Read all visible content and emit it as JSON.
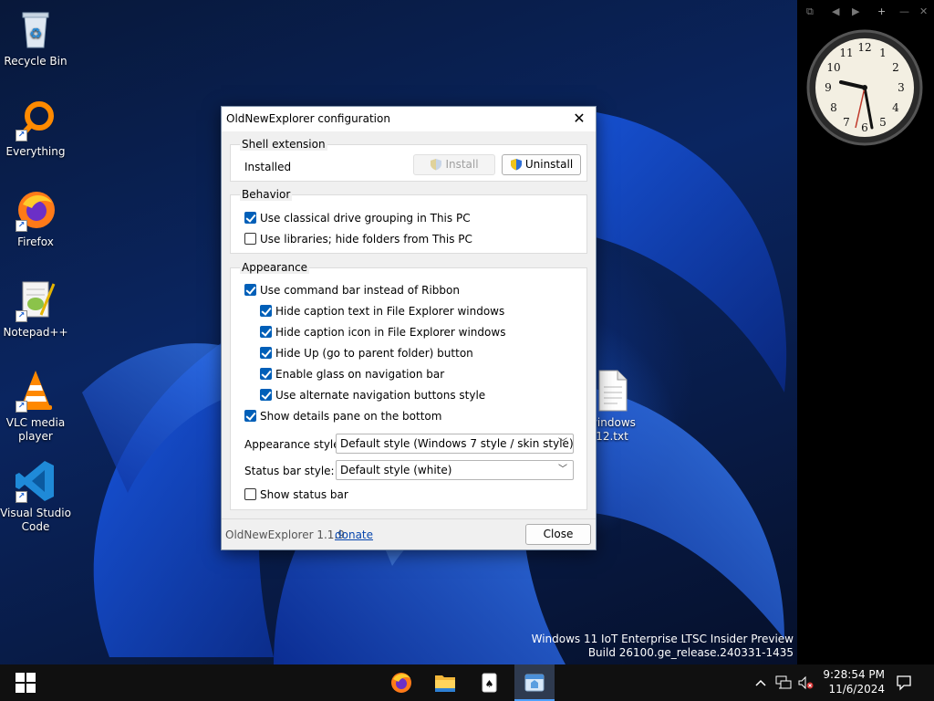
{
  "desktop": {
    "icons": [
      {
        "label": "Recycle Bin"
      },
      {
        "label": "Everything"
      },
      {
        "label": "Firefox"
      },
      {
        "label": "Notepad++"
      },
      {
        "label": "VLC media player"
      },
      {
        "label": "Visual Studio Code"
      },
      {
        "label": "windows 12.txt"
      }
    ],
    "watermark_line1": "Windows 11 IoT Enterprise LTSC Insider Preview",
    "watermark_line2": "Build 26100.ge_release.240331-1435"
  },
  "sidebar": {
    "toolbar": [
      "⧉",
      "◀",
      "▶",
      "+",
      "—",
      "✕"
    ]
  },
  "dialog": {
    "title": "OldNewExplorer configuration",
    "close_glyph": "✕",
    "shell_extension": {
      "label": "Shell extension",
      "status": "Installed",
      "install_label": "Install",
      "uninstall_label": "Uninstall"
    },
    "behavior": {
      "label": "Behavior",
      "options": [
        {
          "label": "Use classical drive grouping in This PC",
          "checked": true
        },
        {
          "label": "Use libraries; hide folders from This PC",
          "checked": false
        }
      ]
    },
    "appearance": {
      "label": "Appearance",
      "options": [
        {
          "label": "Use command bar instead of Ribbon",
          "checked": true
        },
        {
          "label": "Hide caption text in File Explorer windows",
          "checked": true
        },
        {
          "label": "Hide caption icon in File Explorer windows",
          "checked": true
        },
        {
          "label": "Hide Up (go to parent folder) button",
          "checked": true
        },
        {
          "label": "Enable glass on navigation bar",
          "checked": true
        },
        {
          "label": "Use alternate navigation buttons style",
          "checked": true
        },
        {
          "label": "Show details pane on the bottom",
          "checked": true
        }
      ],
      "appearance_style_label": "Appearance style:",
      "appearance_style_value": "Default style (Windows 7 style / skin style)",
      "status_bar_style_label": "Status bar style:",
      "status_bar_style_value": "Default style (white)",
      "show_status_bar": {
        "label": "Show status bar",
        "checked": false
      }
    },
    "footer": {
      "version": "OldNewExplorer 1.1.9",
      "donate": "donate",
      "close_label": "Close"
    }
  },
  "taskbar": {
    "time": "9:28:54 PM",
    "date": "11/6/2024"
  },
  "colors": {
    "accent": "#005fb8",
    "taskbar": "#101010"
  }
}
